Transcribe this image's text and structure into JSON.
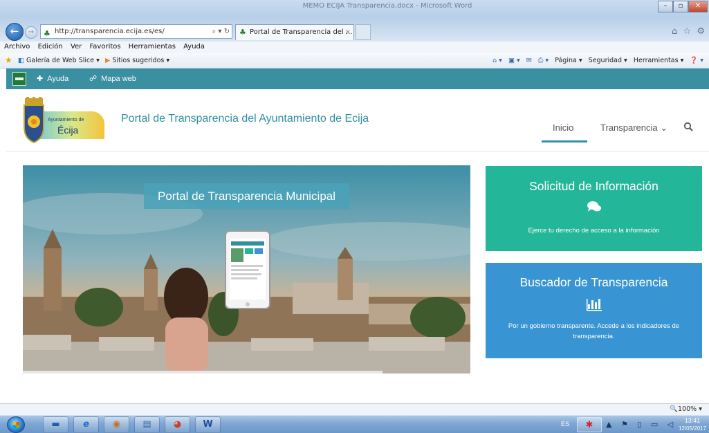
{
  "window": {
    "title": "MEMO ECIJA Transparencia.docx - Microsoft Word",
    "minimize": "–",
    "maximize": "▫",
    "close": "✕"
  },
  "browser": {
    "back": "←",
    "forward": "→",
    "address": "http://transparencia.ecija.es/es/",
    "address_actions": "⌕ ▾ ↻",
    "tab_label": "Portal de Transparencia del ...",
    "tab_close": "×",
    "right_icons": "⌂ ☆ ⚙"
  },
  "menu": [
    "Archivo",
    "Edición",
    "Ver",
    "Favoritos",
    "Herramientas",
    "Ayuda"
  ],
  "favorites": {
    "items": [
      {
        "label": "Galería de Web Slice ▾"
      },
      {
        "label": "Sitios sugeridos ▾"
      }
    ],
    "commands": {
      "home": "⌂ ▾",
      "feeds": "▣ ▾",
      "mail": "✉",
      "print": "⎙ ▾",
      "page": "Página ▾",
      "security": "Seguridad ▾",
      "tools": "Herramientas ▾",
      "help": "❓ ▾"
    }
  },
  "site": {
    "top_links": [
      {
        "icon": "✚",
        "label": "Ayuda"
      },
      {
        "icon": "☍",
        "label": "Mapa web"
      }
    ],
    "logo_small": "Ayuntamiento de",
    "logo_name": "Écija",
    "title": "Portal de Transparencia del Ayuntamiento de Ecija",
    "nav": [
      {
        "label": "Inicio"
      },
      {
        "label": "Transparencia  ⌄"
      }
    ]
  },
  "hero": {
    "banner": "Portal de Transparencia Municipal"
  },
  "cards": [
    {
      "title": "Solicitud de Información",
      "icon": "💬",
      "desc": "Ejerce tu derecho de acceso a la información",
      "color": "#24b699"
    },
    {
      "title": "Buscador de Transparencia",
      "icon": "📊",
      "desc": "Por un gobierno transparente. Accede a los indicadores de transparencia.",
      "color": "#3894d3"
    }
  ],
  "statusbar": {
    "zoom": "🔍100%  ▾"
  },
  "taskbar": {
    "apps": [
      {
        "icon": "▬",
        "color": "#1f5fa8"
      },
      {
        "icon": "e",
        "color": "#1f6fd0"
      },
      {
        "icon": "◉",
        "color": "#d2691e"
      },
      {
        "icon": "▤",
        "color": "#3a6ea5"
      },
      {
        "icon": "◕",
        "color": "#d23a2a"
      },
      {
        "icon": "W",
        "color": "#1f4f9a"
      }
    ],
    "lang": "ES",
    "tray_app": "✱",
    "tray": "▲ ⚑ ▯ ▭ ◁",
    "time": "13:41",
    "date": "12/05/2017"
  }
}
